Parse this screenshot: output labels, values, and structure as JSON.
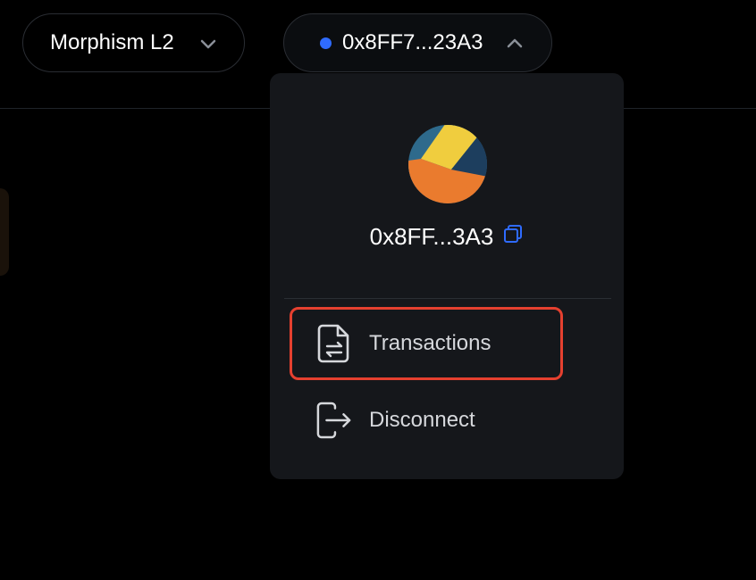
{
  "network_selector": {
    "label": "Morphism L2",
    "icon": "chevron-down-icon"
  },
  "wallet_button": {
    "address_short": "0x8FF7...23A3",
    "status_color": "#2f6bff",
    "icon": "chevron-up-icon"
  },
  "account_menu": {
    "avatar_icon": "jazzicon-avatar",
    "address": "0x8FF...3A3",
    "copy_icon": "copy-icon",
    "items": [
      {
        "label": "Transactions",
        "icon": "document-transfer-icon",
        "highlighted": true,
        "highlight_color": "#e5402f"
      },
      {
        "label": "Disconnect",
        "icon": "logout-icon",
        "highlighted": false
      }
    ]
  },
  "colors": {
    "background": "#000000",
    "panel": "#15171b",
    "accent_blue": "#2f6bff"
  }
}
